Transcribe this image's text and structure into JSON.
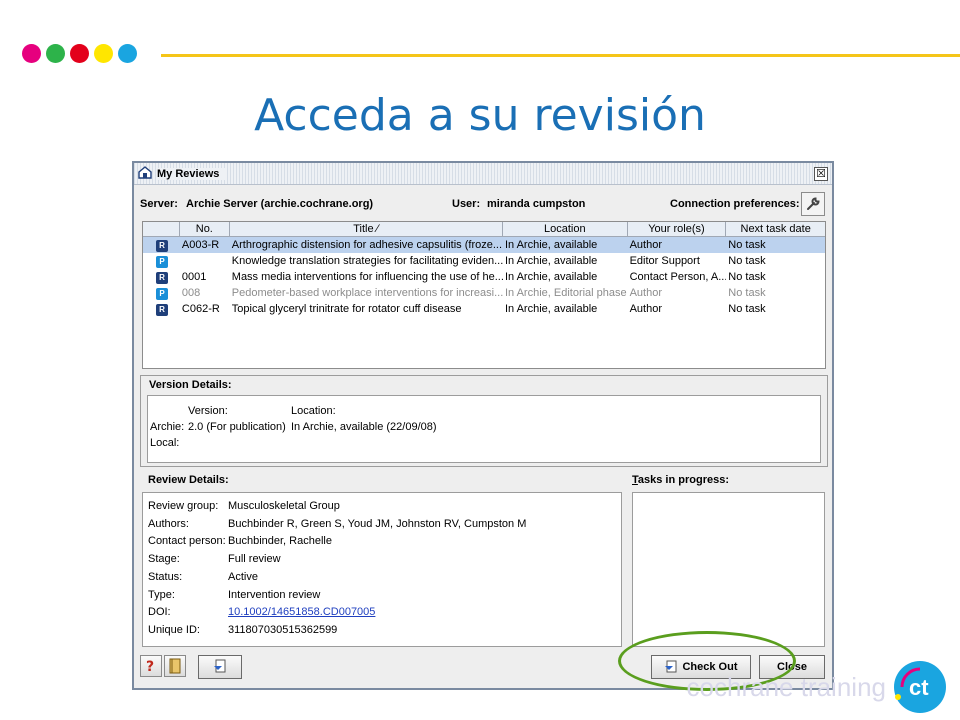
{
  "slide": {
    "title": "Acceda a su revisión",
    "brand": "cochrane training",
    "dot_colors": [
      "#e6007e",
      "#2db34a",
      "#e3001b",
      "#ffe600",
      "#1aa5e0"
    ],
    "rule_color": "#f5c518",
    "title_color": "#1a6fb5",
    "highlight_color": "#5a9e1e"
  },
  "window": {
    "title": "My Reviews",
    "close_glyph": "☒",
    "server_label": "Server:",
    "server_value": "Archie Server (archie.cochrane.org)",
    "user_label": "User:",
    "user_value": "miranda cumpston",
    "conn_label": "Connection preferences:"
  },
  "table": {
    "headers": [
      "",
      "No.",
      "Title ∕",
      "Location",
      "Your role(s)",
      "Next task date"
    ],
    "rows": [
      {
        "icon": "R",
        "no": "A003-R",
        "title": "Arthrographic distension for adhesive capsulitis (froze...",
        "location": "In Archie, available",
        "role": "Author",
        "next": "No task"
      },
      {
        "icon": "P",
        "no": "",
        "title": "Knowledge translation strategies for facilitating eviden...",
        "location": "In Archie, available",
        "role": "Editor Support",
        "next": "No task"
      },
      {
        "icon": "R",
        "no": "0001",
        "title": "Mass media interventions for influencing the use of he...",
        "location": "In Archie, available",
        "role": "Contact Person, A...",
        "next": "No task"
      },
      {
        "icon": "P",
        "no": "008",
        "title": "Pedometer-based workplace interventions for increasi...",
        "location": "In Archie, Editorial phase",
        "role": "Author",
        "next": "No task"
      },
      {
        "icon": "R",
        "no": "C062-R",
        "title": "Topical glyceryl trinitrate for rotator cuff disease",
        "location": "In Archie, available",
        "role": "Author",
        "next": "No task"
      }
    ]
  },
  "version": {
    "heading": "Version Details:",
    "version_label": "Version:",
    "location_label": "Location:",
    "archie_label": "Archie:",
    "archie_version": "2.0 (For publication)",
    "archie_location": "In Archie, available (22/09/08)",
    "local_label": "Local:"
  },
  "review": {
    "heading": "Review Details:",
    "fields": [
      {
        "label": "Review group:",
        "value": "Musculoskeletal Group"
      },
      {
        "label": "Authors:",
        "value": "Buchbinder R, Green S, Youd JM, Johnston RV, Cumpston M"
      },
      {
        "label": "Contact person:",
        "value": "Buchbinder, Rachelle"
      },
      {
        "label": "Stage:",
        "value": "Full review"
      },
      {
        "label": "Status:",
        "value": "Active"
      },
      {
        "label": "Type:",
        "value": "Intervention review"
      },
      {
        "label": "DOI:",
        "value": "10.1002/14651858.CD007005"
      },
      {
        "label": "Unique ID:",
        "value": "311807030515362599"
      }
    ]
  },
  "tasks": {
    "heading_first": "T",
    "heading_rest": "asks in progress:"
  },
  "buttons": {
    "checkout": "Check Out",
    "close": "Close"
  }
}
